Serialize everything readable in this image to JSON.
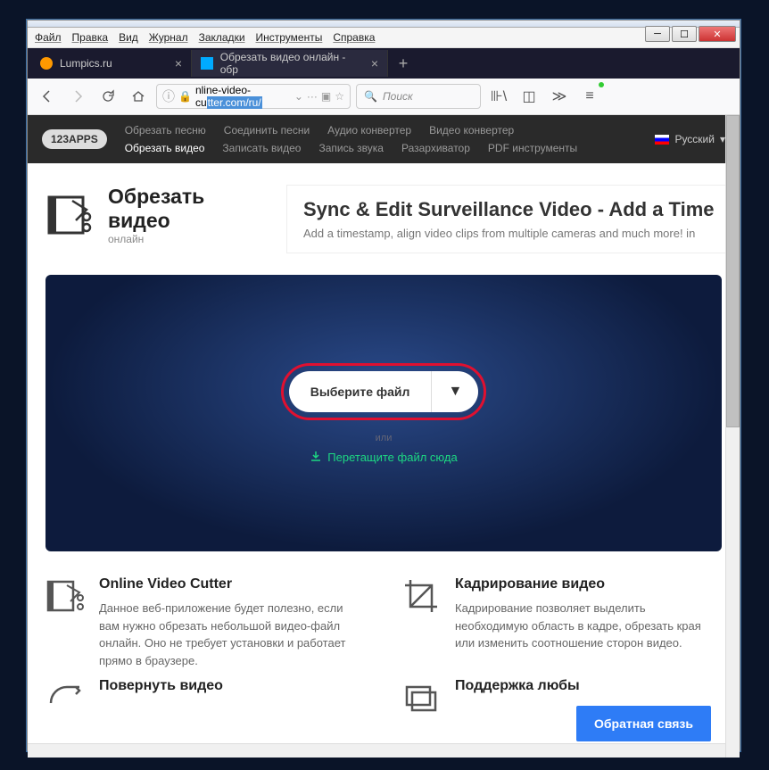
{
  "menu": {
    "file": "Файл",
    "edit": "Правка",
    "view": "Вид",
    "history": "Журнал",
    "bookmarks": "Закладки",
    "tools": "Инструменты",
    "help": "Справка"
  },
  "tabs": {
    "t1": "Lumpics.ru",
    "t2": "Обрезать видео онлайн - обр"
  },
  "url": {
    "pre": "nline-video-cu",
    "sel": "tter.com/ru/"
  },
  "search": {
    "placeholder": "Поиск"
  },
  "nav": {
    "logo": "123APPS",
    "r1": {
      "a": "Обрезать песню",
      "b": "Соединить песни",
      "c": "Аудио конвертер",
      "d": "Видео конвертер"
    },
    "r2": {
      "a": "Обрезать видео",
      "b": "Записать видео",
      "c": "Запись звука",
      "d": "Разархиватор",
      "e": "PDF инструменты"
    },
    "lang": "Русский"
  },
  "header": {
    "title": "Обрезать видео",
    "sub": "онлайн"
  },
  "ad": {
    "title": "Sync & Edit Surveillance Video - Add a Time",
    "text": "Add a timestamp, align video clips from multiple cameras and much more! in"
  },
  "upload": {
    "btn": "Выберите файл",
    "or": "или",
    "drag": "Перетащите файл сюда"
  },
  "f1": {
    "title": "Online Video Cutter",
    "text": "Данное веб-приложение будет полезно, если вам нужно обрезать небольшой видео-файл онлайн. Оно не требует установки и работает прямо в браузере."
  },
  "f2": {
    "title": "Кадрирование видео",
    "text": "Кадрирование позволяет выделить необходимую область в кадре, обрезать края или изменить соотношение сторон видео."
  },
  "f3": {
    "title": "Повернуть видео"
  },
  "f4": {
    "title": "Поддержка любы"
  },
  "feedback": "Обратная связь"
}
